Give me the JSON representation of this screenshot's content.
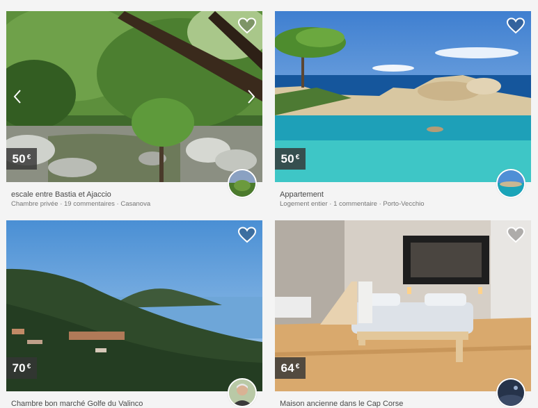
{
  "listings": [
    {
      "price": "50",
      "currency": "€",
      "title": "escale entre Bastia et Ajaccio",
      "meta": "Chambre privée · 19 commentaires · Casanova",
      "carousel": true
    },
    {
      "price": "50",
      "currency": "€",
      "title": "Appartement",
      "meta": "Logement entier · 1 commentaire · Porto-Vecchio",
      "carousel": false
    },
    {
      "price": "70",
      "currency": "€",
      "title": "Chambre bon marché Golfe du Valinco",
      "meta": "",
      "carousel": false
    },
    {
      "price": "64",
      "currency": "€",
      "title": "Maison ancienne dans le Cap Corse",
      "meta": "",
      "carousel": false
    }
  ],
  "icons": {
    "favorite": "heart-icon",
    "previous": "chevron-left-icon",
    "next": "chevron-right-icon"
  },
  "colors": {
    "page_background": "#f4f4f4",
    "title_text": "#484848",
    "meta_text": "#757575",
    "price_badge": "#343434"
  }
}
